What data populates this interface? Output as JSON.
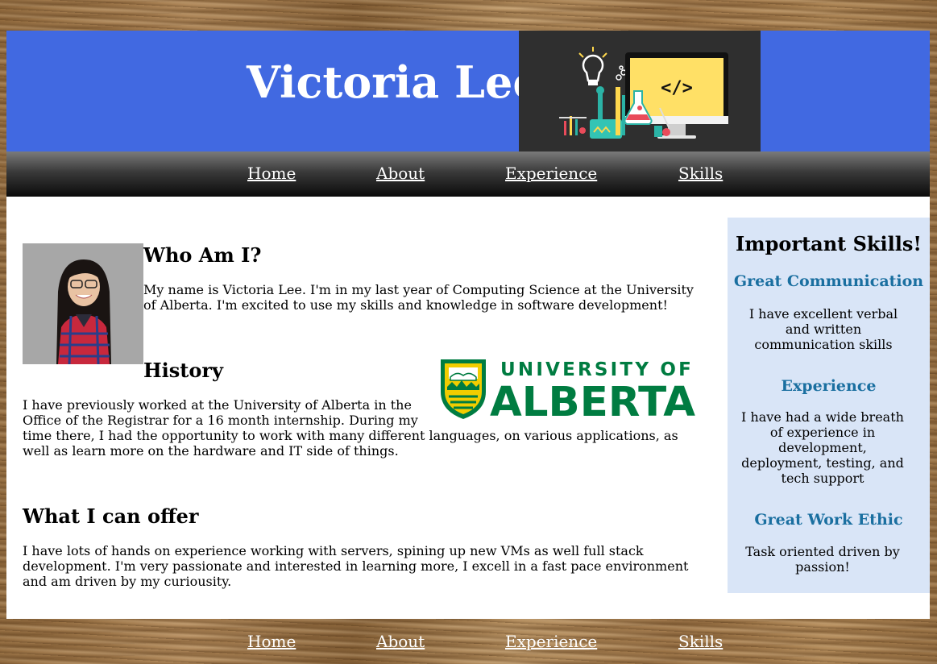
{
  "header": {
    "title": "Victoria Lee",
    "banner_icon": "science-lab-computer-illustration",
    "code_glyph": "</>"
  },
  "nav": {
    "items": [
      {
        "label": "Home"
      },
      {
        "label": "About"
      },
      {
        "label": "Experience"
      },
      {
        "label": "Skills"
      }
    ]
  },
  "main": {
    "who_am_i": {
      "heading": "Who Am I?",
      "text": "My name is Victoria Lee. I'm in my last year of Computing Science at the University of Alberta. I'm excited to use my skills and knowledge in software development!"
    },
    "history": {
      "heading": "History",
      "text_line1": "I have previously worked at the University of Alberta in the",
      "text_line2": "Office of the Registrar for a 16 month internship. During my",
      "text_rest": "time there, I had the opportunity to work with many different languages, on various applications, as well as learn more on the hardware and IT side of things.",
      "logo_top": "UNIVERSITY OF",
      "logo_bottom": "ALBERTA"
    },
    "offer": {
      "heading": "What I can offer",
      "text": "I have lots of hands on experience working with servers, spining up new VMs as well full stack development. I'm very passionate and interested in learning more, I excell in a fast pace environment and am driven by my curiousity."
    }
  },
  "aside": {
    "title": "Important Skills!",
    "skills": [
      {
        "name": "Great Communication",
        "desc": "I have excellent verbal and written communication skills"
      },
      {
        "name": "Experience",
        "desc": "I have had a wide breath of experience in development, deployment, testing, and tech support"
      },
      {
        "name": "Great Work Ethic",
        "desc": "Task oriented driven by passion!"
      }
    ]
  },
  "footer": {
    "items": [
      {
        "label": "Home"
      },
      {
        "label": "About"
      },
      {
        "label": "Experience"
      },
      {
        "label": "Skills"
      }
    ]
  },
  "colors": {
    "banner": "#4169e1",
    "aside_bg": "#d9e5f7",
    "skill_heading": "#1a6fa0",
    "ua_green": "#007c41",
    "ua_gold": "#f2cd00"
  }
}
